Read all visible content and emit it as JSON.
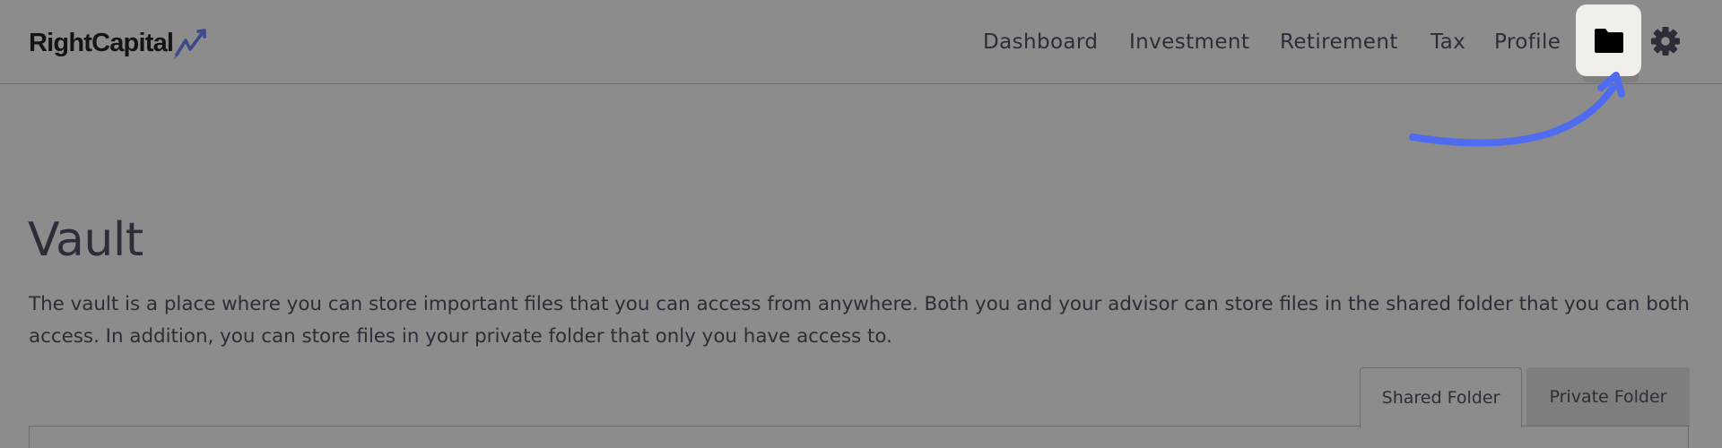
{
  "header": {
    "logo_text": "RightCapital",
    "nav": [
      {
        "label": "Dashboard"
      },
      {
        "label": "Investment"
      },
      {
        "label": "Retirement"
      },
      {
        "label": "Tax"
      },
      {
        "label": "Profile"
      }
    ],
    "icons": {
      "vault": "folder-icon",
      "settings": "gear-icon",
      "logo_mark": "trend-arrow-icon",
      "annotation": "curved-arrow-icon"
    }
  },
  "main": {
    "title": "Vault",
    "description": "The vault is a place where you can store important files that you can access from anywhere. Both you and your advisor can store files in the shared folder that you can both access. In addition, you can store files in your private folder that only you have access to.",
    "tabs": [
      {
        "label": "Shared Folder",
        "active": true
      },
      {
        "label": "Private Folder",
        "active": false
      }
    ]
  },
  "colors": {
    "overlay_background": "#8c8c8c",
    "text": "#2f2b38",
    "highlight": "#f1efe9",
    "annotation_arrow": "#4f6cf0",
    "logo_mark": "#3a4a8a"
  }
}
